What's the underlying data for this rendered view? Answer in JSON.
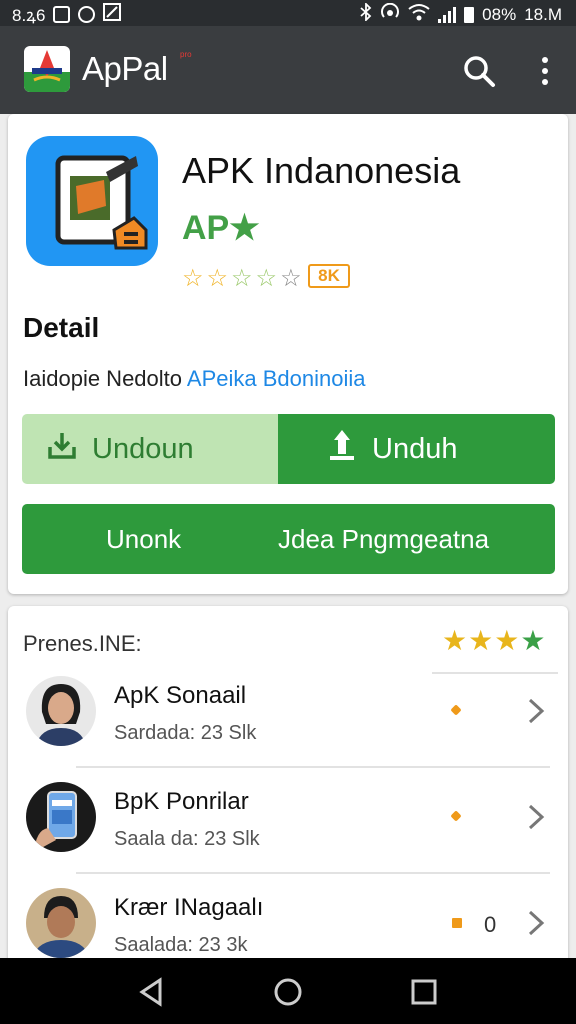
{
  "status_bar": {
    "time_left": "8.ꝝ6",
    "battery": "08%",
    "clock": "18.M"
  },
  "app_bar": {
    "title": "ApPal",
    "badge": "pro",
    "search_icon": "search-icon",
    "more_icon": "more-vert-icon"
  },
  "app": {
    "title": "APK Indanonesia",
    "subtitle": "AP★",
    "rating": {
      "value": 3,
      "max": 5
    },
    "size_badge": "8K"
  },
  "detail": {
    "heading": "Detail",
    "text_plain": "Iаidopie Nedolto ",
    "text_link": "APeika Bdoninoiia"
  },
  "buttons": {
    "download_left": "Undoun",
    "download_right": "Unduh",
    "wide_left": "Unonk",
    "wide_right": "Jdea Pngmgeatna"
  },
  "list": {
    "heading": "Prenes.INE:",
    "items": [
      {
        "name": "ApK Sonaail",
        "meta": "Sardada: 23 Slk",
        "count": ""
      },
      {
        "name": "BpK Ponrilar",
        "meta": "Saala da: 23 Slk",
        "count": ""
      },
      {
        "name": "Krær INagaalı",
        "meta": "Saalada: 23 3k",
        "count": "0"
      }
    ]
  },
  "colors": {
    "accent_green": "#2e9a3c",
    "light_green": "#bfe4b3",
    "app_bar": "#3a3d40",
    "link_blue": "#1e88e5"
  }
}
